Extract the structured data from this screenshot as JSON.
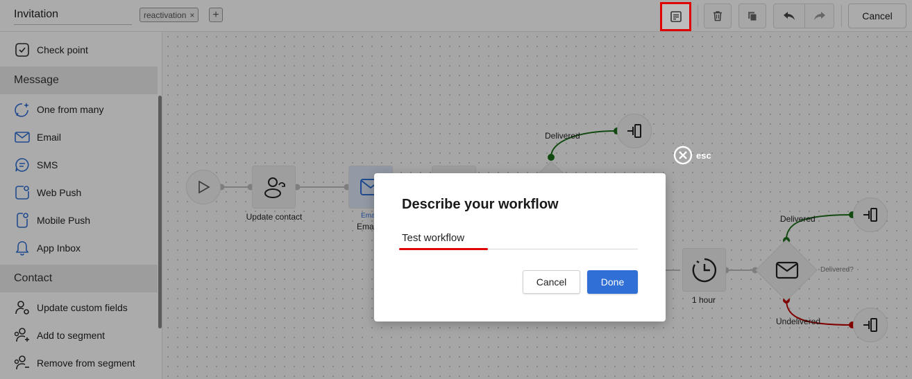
{
  "header": {
    "workflow_name": "Invitation",
    "tag": "reactivation",
    "tag_remove": "×",
    "tag_add": "+",
    "cancel_label": "Cancel"
  },
  "sidebar": {
    "items_top": [
      {
        "label": "Check point",
        "icon": "checkpoint-icon"
      }
    ],
    "sections": [
      {
        "title": "Message",
        "items": [
          {
            "label": "One from many",
            "icon": "sparkle-chat-icon"
          },
          {
            "label": "Email",
            "icon": "envelope-icon"
          },
          {
            "label": "SMS",
            "icon": "sms-bubble-icon"
          },
          {
            "label": "Web Push",
            "icon": "web-push-icon"
          },
          {
            "label": "Mobile Push",
            "icon": "mobile-push-icon"
          },
          {
            "label": "App Inbox",
            "icon": "bell-icon"
          }
        ]
      },
      {
        "title": "Contact",
        "items": [
          {
            "label": "Update custom fields",
            "icon": "user-gear-icon"
          },
          {
            "label": "Add to segment",
            "icon": "user-plus-icon"
          },
          {
            "label": "Remove from segment",
            "icon": "user-minus-icon"
          }
        ]
      }
    ]
  },
  "canvas": {
    "update_contact_label": "Update contact",
    "email_label_small": "Ema",
    "email_label": "Ema",
    "delivered_top": "Delivered",
    "delivered_right": "Delivered",
    "delivered_question": "Delivered?",
    "undelivered": "Undelivered",
    "wait_label": "1 hour"
  },
  "dialog": {
    "title": "Describe your workflow",
    "input_value": "Test workflow",
    "cancel_label": "Cancel",
    "done_label": "Done",
    "esc_label": "esc"
  },
  "colors": {
    "accent": "#2f6fd6",
    "highlight": "#e00000",
    "delivered": "#1a6e1a",
    "undelivered": "#c00000"
  }
}
